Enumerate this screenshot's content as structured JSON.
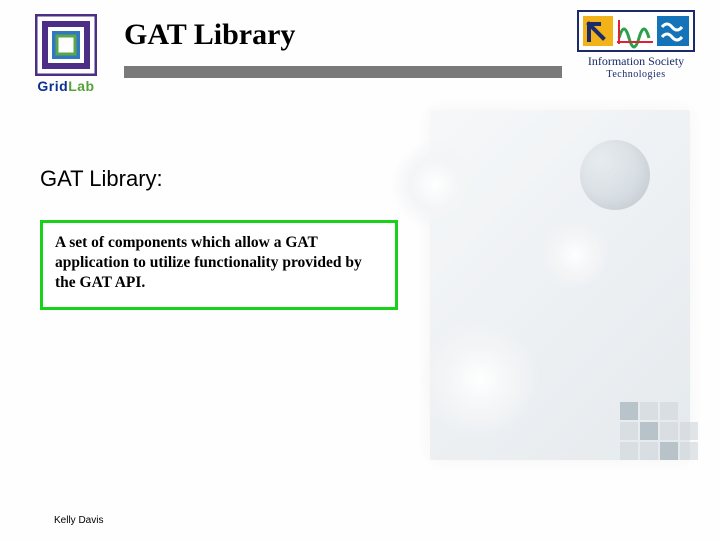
{
  "header": {
    "title": "GAT Library",
    "logo_left": {
      "name": "GridLab",
      "part1": "Grid",
      "part2": "Lab"
    },
    "logo_right": {
      "line1": "Information Society",
      "line2": "Technologies"
    }
  },
  "content": {
    "subhead": "GAT Library:",
    "definition": "A set of components which allow a GAT application to utilize functionality provided by the GAT API."
  },
  "footer": {
    "author": "Kelly Davis"
  }
}
